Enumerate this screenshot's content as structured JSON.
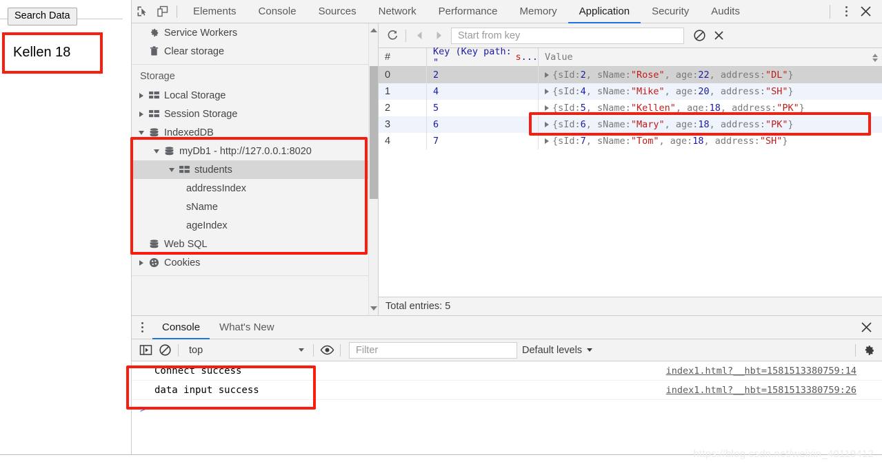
{
  "page": {
    "search_button_label": "Search Data",
    "result_text": "Kellen 18"
  },
  "devtools": {
    "toolbar_icons": [
      {
        "name": "inspect-element-icon",
        "label": "Inspect element"
      },
      {
        "name": "device-toolbar-icon",
        "label": "Toggle device toolbar"
      }
    ],
    "tabs": [
      {
        "label": "Elements",
        "active": false
      },
      {
        "label": "Console",
        "active": false
      },
      {
        "label": "Sources",
        "active": false
      },
      {
        "label": "Network",
        "active": false
      },
      {
        "label": "Performance",
        "active": false
      },
      {
        "label": "Memory",
        "active": false
      },
      {
        "label": "Application",
        "active": true
      },
      {
        "label": "Security",
        "active": false
      },
      {
        "label": "Audits",
        "active": false
      }
    ],
    "more_label": "More options",
    "close_label": "Close DevTools",
    "accent_color": "#1a73e8"
  },
  "sidebar": {
    "top_items": [
      {
        "label": "Service Workers",
        "icon": "gear-icon",
        "indent": 0,
        "arrow": "none"
      },
      {
        "label": "Clear storage",
        "icon": "trash-icon",
        "indent": 0,
        "arrow": "none"
      }
    ],
    "section_title": "Storage",
    "tree": [
      {
        "label": "Local Storage",
        "icon": "table-icon",
        "indent": 0,
        "arrow": "right",
        "selected": false
      },
      {
        "label": "Session Storage",
        "icon": "table-icon",
        "indent": 0,
        "arrow": "right",
        "selected": false
      },
      {
        "label": "IndexedDB",
        "icon": "database-icon",
        "indent": 0,
        "arrow": "down",
        "selected": false
      },
      {
        "label": "myDb1 - http://127.0.0.1:8020",
        "icon": "database-icon",
        "indent": 1,
        "arrow": "down",
        "selected": false
      },
      {
        "label": "students",
        "icon": "table-icon",
        "indent": 2,
        "arrow": "down",
        "selected": true
      },
      {
        "label": "addressIndex",
        "icon": "none",
        "indent": 3,
        "arrow": "none",
        "selected": false
      },
      {
        "label": "sName",
        "icon": "none",
        "indent": 3,
        "arrow": "none",
        "selected": false
      },
      {
        "label": "ageIndex",
        "icon": "none",
        "indent": 3,
        "arrow": "none",
        "selected": false
      },
      {
        "label": "Web SQL",
        "icon": "database-icon",
        "indent": 0,
        "arrow": "none",
        "selected": false
      },
      {
        "label": "Cookies",
        "icon": "cookie-icon",
        "indent": 0,
        "arrow": "right",
        "selected": false
      }
    ]
  },
  "db_toolbar": {
    "refresh_label": "Refresh",
    "prev_label": "Show previous page",
    "next_label": "Show next page",
    "start_from_key_placeholder": "Start from key",
    "start_from_key_value": "",
    "clear_object_store_label": "Clear object store",
    "delete_selected_label": "Delete selected"
  },
  "table": {
    "columns": [
      {
        "key": "index",
        "label": "#"
      },
      {
        "key": "key",
        "label_prefix": "Key (Key path: \"",
        "label_string": "s",
        "label_suffix": "..."
      },
      {
        "key": "value",
        "label": "Value"
      }
    ],
    "rows": [
      {
        "index": "0",
        "key": "2",
        "sId": "2",
        "sName": "Rose",
        "age": "22",
        "address": "DL",
        "selected": true,
        "highlighted": false
      },
      {
        "index": "1",
        "key": "4",
        "sId": "4",
        "sName": "Mike",
        "age": "20",
        "address": "SH",
        "selected": false,
        "highlighted": false
      },
      {
        "index": "2",
        "key": "5",
        "sId": "5",
        "sName": "Kellen",
        "age": "18",
        "address": "PK",
        "selected": false,
        "highlighted": true
      },
      {
        "index": "3",
        "key": "6",
        "sId": "6",
        "sName": "Mary",
        "age": "18",
        "address": "PK",
        "selected": false,
        "highlighted": false
      },
      {
        "index": "4",
        "key": "7",
        "sId": "7",
        "sName": "Tom",
        "age": "18",
        "address": "SH",
        "selected": false,
        "highlighted": false
      }
    ],
    "footer": "Total entries: 5"
  },
  "drawer": {
    "tabs": [
      {
        "label": "Console",
        "active": true
      },
      {
        "label": "What's New",
        "active": false
      }
    ],
    "close_label": "Close drawer",
    "more_label": "More tools",
    "console_toolbar": {
      "sidebar_toggle_label": "Show console sidebar",
      "clear_label": "Clear console",
      "context": "top",
      "eye_label": "Create live expression",
      "filter_placeholder": "Filter",
      "filter_value": "",
      "levels_label": "Default levels",
      "settings_label": "Console settings"
    },
    "logs": [
      {
        "message": "Connect success",
        "source": "index1.html?__hbt=1581513380759:14"
      },
      {
        "message": "data input success",
        "source": "index1.html?__hbt=1581513380759:26"
      }
    ],
    "prompt": ">"
  },
  "annotations": {
    "color": "#f81d0e",
    "boxes": [
      "result-text-box",
      "indexeddb-tree-box",
      "kellen-row-box",
      "console-log-box"
    ]
  },
  "watermark": "https://blog.csdn.net/weixin_40119412"
}
